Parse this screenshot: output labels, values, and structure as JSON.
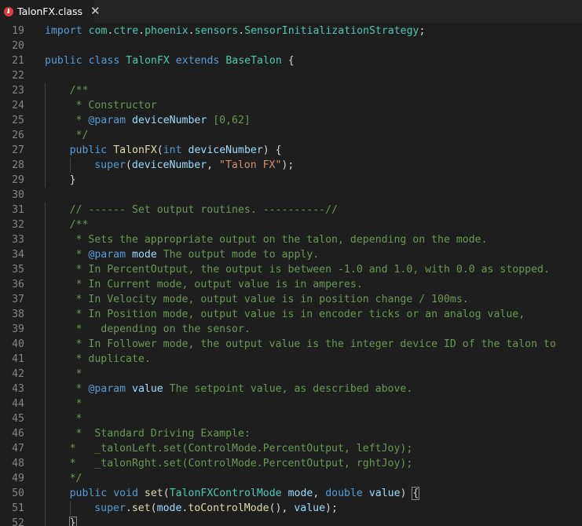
{
  "tab": {
    "title": "TalonFX.class",
    "close_glyph": "✕",
    "icon": "java-file-icon"
  },
  "lines": [
    {
      "n": "19",
      "indent": 0,
      "tokens": [
        [
          "kw",
          "import"
        ],
        [
          "pl",
          " "
        ],
        [
          "ty",
          "com"
        ],
        [
          "pl",
          "."
        ],
        [
          "ty",
          "ctre"
        ],
        [
          "pl",
          "."
        ],
        [
          "ty",
          "phoenix"
        ],
        [
          "pl",
          "."
        ],
        [
          "ty",
          "sensors"
        ],
        [
          "pl",
          "."
        ],
        [
          "ty",
          "SensorInitializationStrategy"
        ],
        [
          "pl",
          ";"
        ]
      ]
    },
    {
      "n": "20",
      "indent": 0,
      "tokens": []
    },
    {
      "n": "21",
      "indent": 0,
      "tokens": [
        [
          "kw",
          "public"
        ],
        [
          "pl",
          " "
        ],
        [
          "kw",
          "class"
        ],
        [
          "pl",
          " "
        ],
        [
          "ty",
          "TalonFX"
        ],
        [
          "pl",
          " "
        ],
        [
          "kw",
          "extends"
        ],
        [
          "pl",
          " "
        ],
        [
          "ty",
          "BaseTalon"
        ],
        [
          "pl",
          " {"
        ]
      ]
    },
    {
      "n": "22",
      "indent": 0,
      "tokens": []
    },
    {
      "n": "23",
      "indent": 1,
      "tokens": [
        [
          "cm",
          "/**"
        ]
      ]
    },
    {
      "n": "24",
      "indent": 1,
      "tokens": [
        [
          "cm",
          " * Constructor"
        ]
      ]
    },
    {
      "n": "25",
      "indent": 1,
      "tokens": [
        [
          "cm",
          " * "
        ],
        [
          "jd",
          "@param"
        ],
        [
          "pl",
          " "
        ],
        [
          "jv",
          "deviceNumber"
        ],
        [
          "cm",
          " [0,62]"
        ]
      ]
    },
    {
      "n": "26",
      "indent": 1,
      "tokens": [
        [
          "cm",
          " */"
        ]
      ]
    },
    {
      "n": "27",
      "indent": 1,
      "tokens": [
        [
          "kw",
          "public"
        ],
        [
          "pl",
          " "
        ],
        [
          "fn",
          "TalonFX"
        ],
        [
          "pl",
          "("
        ],
        [
          "kw",
          "int"
        ],
        [
          "pl",
          " "
        ],
        [
          "vr",
          "deviceNumber"
        ],
        [
          "pl",
          ") {"
        ]
      ]
    },
    {
      "n": "28",
      "indent": 2,
      "tokens": [
        [
          "kw",
          "super"
        ],
        [
          "pl",
          "("
        ],
        [
          "vr",
          "deviceNumber"
        ],
        [
          "pl",
          ", "
        ],
        [
          "st",
          "\"Talon FX\""
        ],
        [
          "pl",
          ");"
        ]
      ]
    },
    {
      "n": "29",
      "indent": 1,
      "tokens": [
        [
          "pl",
          "}"
        ]
      ]
    },
    {
      "n": "30",
      "indent": 0,
      "tokens": []
    },
    {
      "n": "31",
      "indent": 1,
      "tokens": [
        [
          "cm",
          "// ------ Set output routines. ----------//"
        ]
      ]
    },
    {
      "n": "32",
      "indent": 1,
      "tokens": [
        [
          "cm",
          "/**"
        ]
      ]
    },
    {
      "n": "33",
      "indent": 1,
      "tokens": [
        [
          "cm",
          " * Sets the appropriate output on the talon, depending on the mode."
        ]
      ]
    },
    {
      "n": "34",
      "indent": 1,
      "tokens": [
        [
          "cm",
          " * "
        ],
        [
          "jd",
          "@param"
        ],
        [
          "pl",
          " "
        ],
        [
          "jv",
          "mode"
        ],
        [
          "cm",
          " The output mode to apply."
        ]
      ]
    },
    {
      "n": "35",
      "indent": 1,
      "tokens": [
        [
          "cm",
          " * In PercentOutput, the output is between -1.0 and 1.0, with 0.0 as stopped."
        ]
      ]
    },
    {
      "n": "36",
      "indent": 1,
      "tokens": [
        [
          "cm",
          " * In Current mode, output value is in amperes."
        ]
      ]
    },
    {
      "n": "37",
      "indent": 1,
      "tokens": [
        [
          "cm",
          " * In Velocity mode, output value is in position change / 100ms."
        ]
      ]
    },
    {
      "n": "38",
      "indent": 1,
      "tokens": [
        [
          "cm",
          " * In Position mode, output value is in encoder ticks or an analog value,"
        ]
      ]
    },
    {
      "n": "39",
      "indent": 1,
      "tokens": [
        [
          "cm",
          " *   depending on the sensor."
        ]
      ]
    },
    {
      "n": "40",
      "indent": 1,
      "tokens": [
        [
          "cm",
          " * In Follower mode, the output value is the integer device ID of the talon to"
        ]
      ]
    },
    {
      "n": "41",
      "indent": 1,
      "tokens": [
        [
          "cm",
          " * duplicate."
        ]
      ]
    },
    {
      "n": "42",
      "indent": 1,
      "tokens": [
        [
          "cm",
          " *"
        ]
      ]
    },
    {
      "n": "43",
      "indent": 1,
      "tokens": [
        [
          "cm",
          " * "
        ],
        [
          "jd",
          "@param"
        ],
        [
          "pl",
          " "
        ],
        [
          "jv",
          "value"
        ],
        [
          "cm",
          " The setpoint value, as described above."
        ]
      ]
    },
    {
      "n": "44",
      "indent": 1,
      "tokens": [
        [
          "cm",
          " *"
        ]
      ]
    },
    {
      "n": "45",
      "indent": 1,
      "tokens": [
        [
          "cm",
          " *"
        ]
      ]
    },
    {
      "n": "46",
      "indent": 1,
      "tokens": [
        [
          "cm",
          " *  Standard Driving Example:"
        ]
      ]
    },
    {
      "n": "47",
      "indent": 1,
      "tokens": [
        [
          "cm",
          "*   _talonLeft.set(ControlMode.PercentOutput, leftJoy);"
        ]
      ]
    },
    {
      "n": "48",
      "indent": 1,
      "tokens": [
        [
          "cm",
          "*   _talonRght.set(ControlMode.PercentOutput, rghtJoy);"
        ]
      ]
    },
    {
      "n": "49",
      "indent": 1,
      "tokens": [
        [
          "cm",
          "*/"
        ]
      ]
    },
    {
      "n": "50",
      "indent": 1,
      "tokens": [
        [
          "kw",
          "public"
        ],
        [
          "pl",
          " "
        ],
        [
          "kw",
          "void"
        ],
        [
          "pl",
          " "
        ],
        [
          "fn",
          "set"
        ],
        [
          "pl",
          "("
        ],
        [
          "ty",
          "TalonFXControlMode"
        ],
        [
          "pl",
          " "
        ],
        [
          "vr",
          "mode"
        ],
        [
          "pl",
          ", "
        ],
        [
          "kw",
          "double"
        ],
        [
          "pl",
          " "
        ],
        [
          "vr",
          "value"
        ],
        [
          "pl",
          ") "
        ],
        [
          "box",
          "{"
        ]
      ]
    },
    {
      "n": "51",
      "indent": 2,
      "tokens": [
        [
          "kw",
          "super"
        ],
        [
          "pl",
          "."
        ],
        [
          "fn",
          "set"
        ],
        [
          "pl",
          "("
        ],
        [
          "vr",
          "mode"
        ],
        [
          "pl",
          "."
        ],
        [
          "fn",
          "toControlMode"
        ],
        [
          "pl",
          "(), "
        ],
        [
          "vr",
          "value"
        ],
        [
          "pl",
          ");"
        ]
      ]
    },
    {
      "n": "52",
      "indent": 1,
      "tokens": [
        [
          "box",
          "}"
        ]
      ]
    }
  ]
}
